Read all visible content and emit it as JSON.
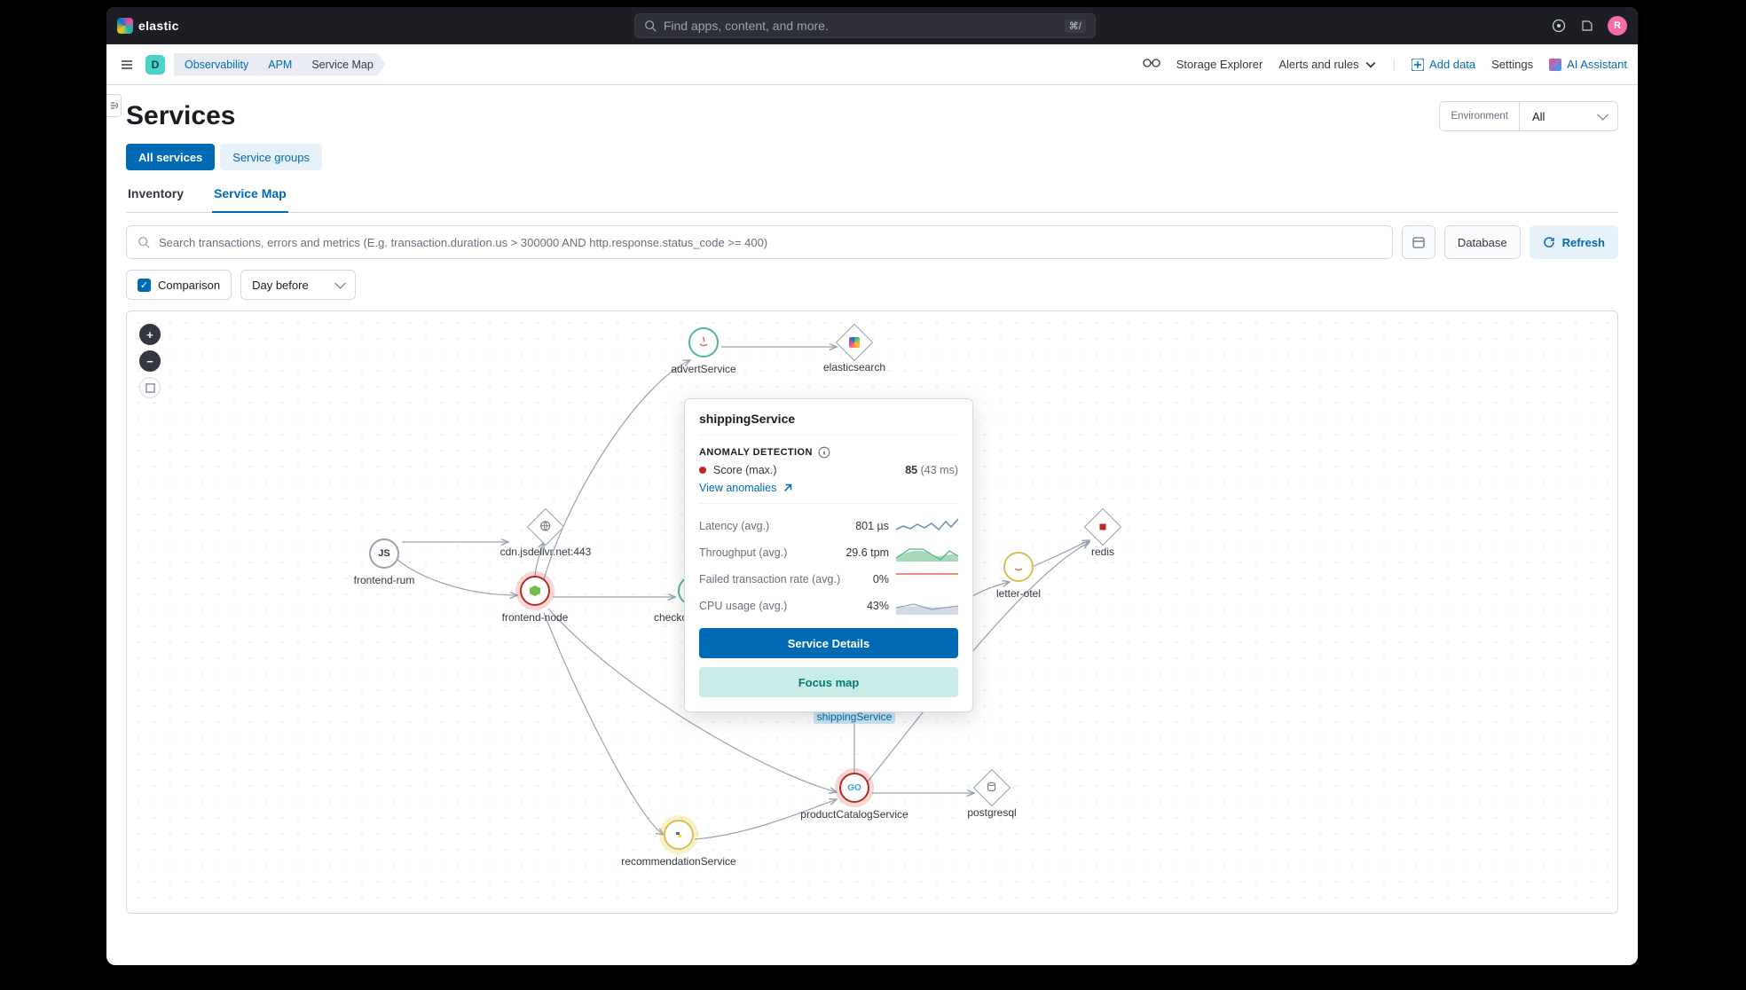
{
  "brand": "elastic",
  "search": {
    "placeholder": "Find apps, content, and more.",
    "shortcut": "⌘/"
  },
  "avatar_initial": "R",
  "breadcrumbs": [
    "Observability",
    "APM",
    "Service Map"
  ],
  "space_badge": "D",
  "sub_links": {
    "storage": "Storage Explorer",
    "alerts": "Alerts and rules",
    "add_data": "Add data",
    "settings": "Settings",
    "ai": "AI Assistant"
  },
  "page_title": "Services",
  "env": {
    "label": "Environment",
    "value": "All"
  },
  "pill_tabs": {
    "all": "All services",
    "groups": "Service groups"
  },
  "line_tabs": {
    "inventory": "Inventory",
    "service_map": "Service Map"
  },
  "query_placeholder": "Search transactions, errors and metrics (E.g. transaction.duration.us > 300000 AND http.response.status_code >= 400)",
  "datepicker_label": "Database",
  "refresh": "Refresh",
  "comparison": {
    "label": "Comparison",
    "range": "Day before"
  },
  "nodes": {
    "frontend_rum": "frontend-rum",
    "frontend_node": "frontend-node",
    "cdn": "cdn.jsdelivr.net:443",
    "advert": "advertService",
    "elasticsearch": "elasticsearch",
    "checkout": "checkoutService",
    "shipping": "shippingService",
    "product": "productCatalogService",
    "recommendation": "recommendationService",
    "redis": "redis",
    "letter": "letter-otel",
    "postgresql": "postgresql",
    "js_badge": "JS"
  },
  "popover": {
    "title": "shippingService",
    "section": "ANOMALY DETECTION",
    "score_label": "Score (max.)",
    "score_value": "85",
    "score_sub": "(43 ms)",
    "view_anomalies": "View anomalies",
    "metrics": [
      {
        "label": "Latency (avg.)",
        "value": "801 µs"
      },
      {
        "label": "Throughput (avg.)",
        "value": "29.6 tpm"
      },
      {
        "label": "Failed transaction rate (avg.)",
        "value": "0%"
      },
      {
        "label": "CPU usage (avg.)",
        "value": "43%"
      }
    ],
    "btn_details": "Service Details",
    "btn_focus": "Focus map"
  }
}
